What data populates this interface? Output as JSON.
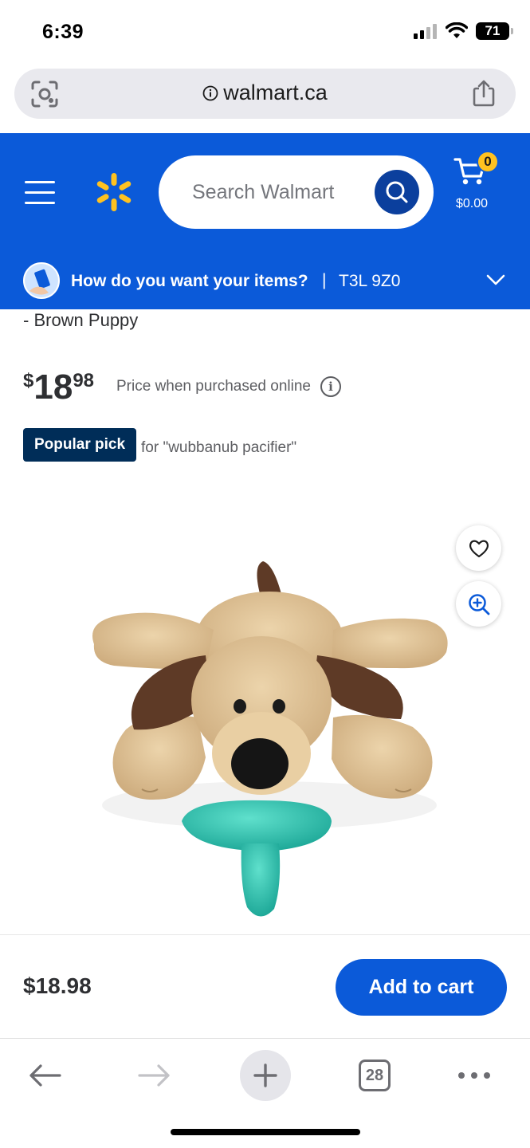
{
  "status_bar": {
    "time": "6:39",
    "battery": "71"
  },
  "browser": {
    "url": "walmart.ca",
    "open_tabs": "28"
  },
  "header": {
    "search_placeholder": "Search Walmart",
    "cart_count": "0",
    "cart_total": "$0.00",
    "delivery_question": "How do you want your items?",
    "delivery_separator": "|",
    "postal_code": "T3L 9Z0"
  },
  "product": {
    "title_tail": "- Brown Puppy",
    "price_currency": "$",
    "price_dollars": "18",
    "price_cents": "98",
    "price_note": "Price when purchased online",
    "badge": "Popular pick",
    "badge_query": "for \"wubbanub pacifier\""
  },
  "sticky": {
    "price": "$18.98",
    "add_to_cart": "Add to cart"
  },
  "colors": {
    "brand_blue": "#0b5ad9",
    "spark_yellow": "#ffc220",
    "navy": "#002d58"
  }
}
